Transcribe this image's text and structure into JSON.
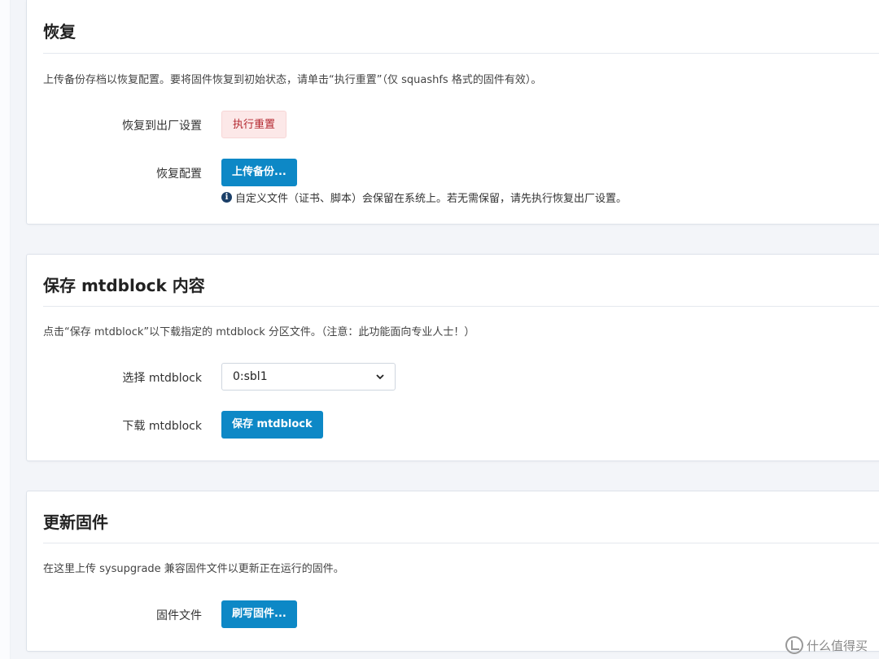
{
  "restore": {
    "title": "恢复",
    "description": "上传备份存档以恢复配置。要将固件恢复到初始状态，请单击“执行重置”（仅 squashfs 格式的固件有效）。",
    "factory_label": "恢复到出厂设置",
    "reset_button": "执行重置",
    "restore_label": "恢复配置",
    "upload_button": "上传备份...",
    "hint": "自定义文件（证书、脚本）会保留在系统上。若无需保留，请先执行恢复出厂设置。"
  },
  "mtdblock": {
    "title": "保存 mtdblock 内容",
    "description": "点击“保存 mtdblock”以下载指定的 mtdblock 分区文件。（注意：此功能面向专业人士！）",
    "select_label": "选择 mtdblock",
    "select_value": "0:sbl1",
    "download_label": "下载 mtdblock",
    "save_button": "保存 mtdblock"
  },
  "firmware": {
    "title": "更新固件",
    "description": "在这里上传 sysupgrade 兼容固件文件以更新正在运行的固件。",
    "file_label": "固件文件",
    "flash_button": "刷写固件..."
  },
  "watermark": {
    "text": "什么值得买"
  },
  "colors": {
    "primary": "#0d88c6",
    "danger_text": "#b3262e",
    "danger_bg": "#fce8e8"
  }
}
